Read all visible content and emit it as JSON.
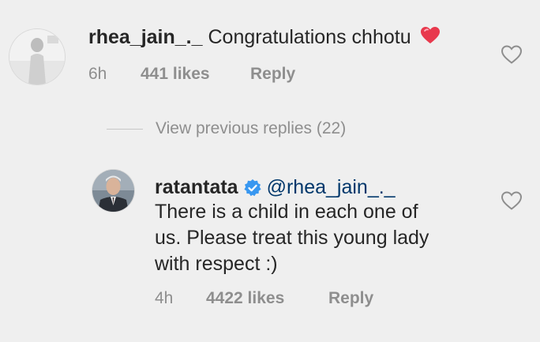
{
  "comment1": {
    "username": "rhea_jain_._",
    "text": "Congratulations chhotu",
    "emoji_icon": "heart-emoji-icon",
    "time": "6h",
    "likes": "441 likes",
    "reply_label": "Reply",
    "like_icon": "heart-outline-icon"
  },
  "view_previous": {
    "label": "View previous replies (22)"
  },
  "comment2": {
    "username": "ratantata",
    "verified_icon": "verified-badge-icon",
    "mention": "@rhea_jain_._",
    "lines": [
      "There is a child in each one of",
      "us. Please treat this young lady",
      "with respect :)"
    ],
    "time": "4h",
    "likes": "4422 likes",
    "reply_label": "Reply",
    "like_icon": "heart-outline-icon"
  },
  "colors": {
    "background": "#efefef",
    "text": "#262626",
    "secondary": "#8e8e8e",
    "mention": "#00376b",
    "verified": "#3897f0",
    "emoji_heart": "#e8394d"
  }
}
